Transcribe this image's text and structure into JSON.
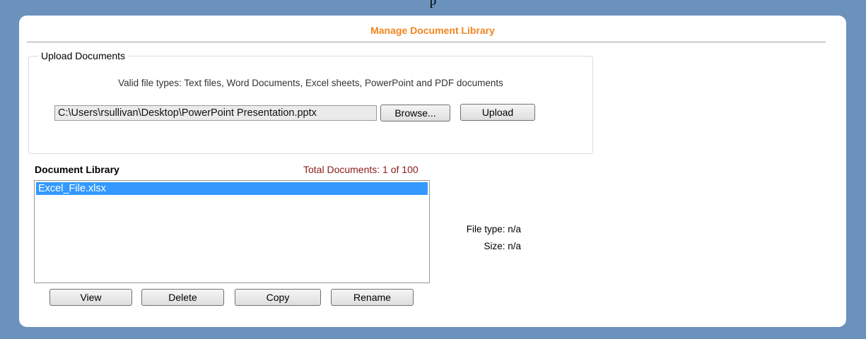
{
  "top_caption": "p",
  "panel": {
    "title": "Manage Document Library"
  },
  "upload": {
    "legend": "Upload Documents",
    "valid_types": "Valid file types: Text files, Word Documents, Excel sheets, PowerPoint and PDF documents",
    "file_path": "C:\\Users\\rsullivan\\Desktop\\PowerPoint Presentation.pptx",
    "browse_label": "Browse...",
    "upload_label": "Upload"
  },
  "library": {
    "title": "Document Library",
    "total_label": "Total Documents: 1 of 100",
    "items": [
      "Excel_File.xlsx"
    ],
    "selected_index": 0,
    "file_type_label": "File type: n/a",
    "size_label": "Size: n/a",
    "buttons": {
      "view": "View",
      "delete": "Delete",
      "copy": "Copy",
      "rename": "Rename"
    }
  },
  "colors": {
    "background": "#6b91bd",
    "panel": "#ffffff",
    "title": "#f0861e",
    "total_docs": "#8b1a1a",
    "selection": "#3399ff"
  }
}
